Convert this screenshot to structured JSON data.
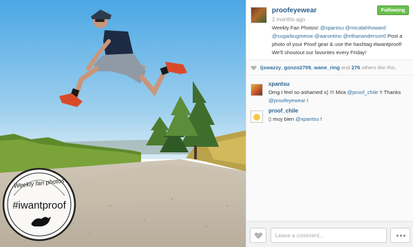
{
  "post": {
    "username": "proofeyewear",
    "time_ago": "2 months ago",
    "follow_label": "Following",
    "caption": [
      {
        "text": "Weekly Fan Photos! ",
        "mention": false
      },
      {
        "text": "@xpantsu",
        "mention": true
      },
      {
        "text": " ",
        "mention": false
      },
      {
        "text": "@micalahhoward",
        "mention": true
      },
      {
        "text": " ",
        "mention": false
      },
      {
        "text": "@sugarbugmeow",
        "mention": true
      },
      {
        "text": " ",
        "mention": false
      },
      {
        "text": "@aarontino",
        "mention": true
      },
      {
        "text": " ",
        "mention": false
      },
      {
        "text": "@ethananderson0",
        "mention": true
      },
      {
        "text": " Post a photo of your Proof gear & use the hashtag #iwantproof! We'll shoutout our favorites every Friday!",
        "mention": false
      }
    ]
  },
  "likes": {
    "users": [
      "ljswazzy",
      "gonzo2709",
      "wane_ring"
    ],
    "conjunction": "and",
    "count": "276",
    "rest": "others like this."
  },
  "comments": [
    {
      "user": "xpantsu",
      "parts": [
        {
          "text": "Omg I feel so ashamed x) !!! Mira ",
          "mention": false
        },
        {
          "text": "@proof_chile",
          "mention": true
        },
        {
          "text": " !! Thanks ",
          "mention": false
        },
        {
          "text": "@proofeyewear",
          "mention": true
        },
        {
          "text": " !",
          "mention": false
        }
      ]
    },
    {
      "user": "proof_chile",
      "parts": [
        {
          "text": "▯ muy bien ",
          "mention": false
        },
        {
          "text": "@xpantsu",
          "mention": true
        },
        {
          "text": " !",
          "mention": false
        }
      ]
    }
  ],
  "stamp": {
    "top_text": "Weekly fan photos",
    "hashtag": "#iwantproof"
  },
  "compose": {
    "placeholder": "Leave a comment..."
  },
  "colors": {
    "link": "#2f6f9f",
    "follow_green": "#6bbf4e",
    "sky": "#6fb8e6"
  }
}
